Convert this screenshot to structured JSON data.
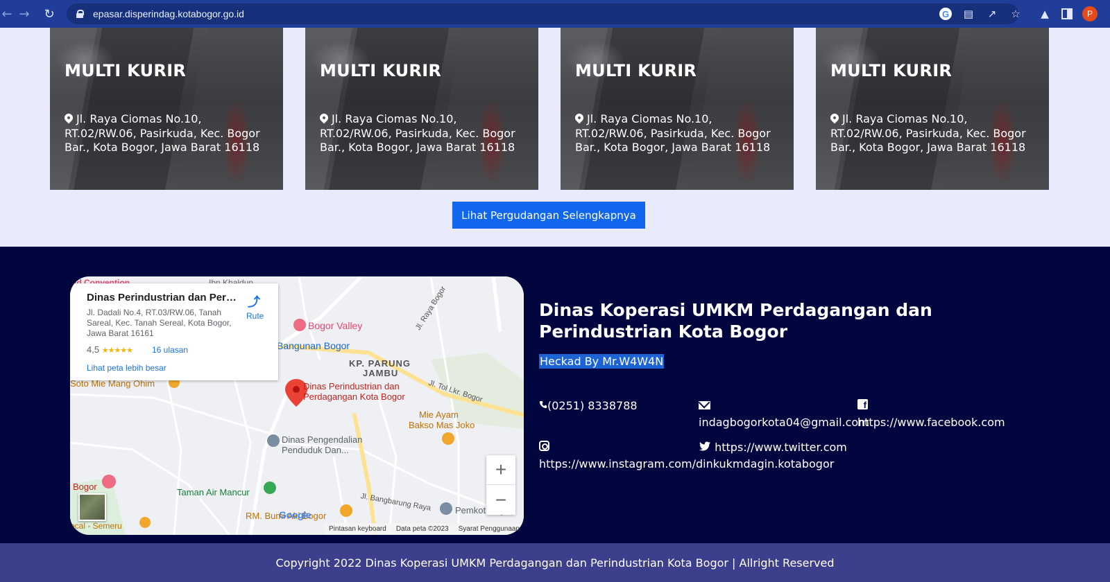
{
  "browser": {
    "url": "epasar.disperindag.kotabogor.go.id",
    "profile_initial": "P",
    "icons": [
      "back-icon",
      "forward-icon",
      "reload-icon",
      "lock-icon",
      "google-icon",
      "translate-icon",
      "share-icon",
      "star-icon",
      "extensions-icon",
      "sidebar-icon",
      "profile-avatar"
    ]
  },
  "warehouses": [
    {
      "name": "MULTI KURIR",
      "address": "Jl. Raya Ciomas No.10, RT.02/RW.06, Pasirkuda, Kec. Bogor Bar., Kota Bogor, Jawa Barat 16118"
    },
    {
      "name": "MULTI KURIR",
      "address": "Jl. Raya Ciomas No.10, RT.02/RW.06, Pasirkuda, Kec. Bogor Bar., Kota Bogor, Jawa Barat 16118"
    },
    {
      "name": "MULTI KURIR",
      "address": "Jl. Raya Ciomas No.10, RT.02/RW.06, Pasirkuda, Kec. Bogor Bar., Kota Bogor, Jawa Barat 16118"
    },
    {
      "name": "MULTI KURIR",
      "address": "Jl. Raya Ciomas No.10, RT.02/RW.06, Pasirkuda, Kec. Bogor Bar., Kota Bogor, Jawa Barat 16118"
    }
  ],
  "more_button": "Lihat Pergudangan Selengkapnya",
  "map": {
    "place_title": "Dinas Perindustrian dan Perda...",
    "place_address": "Jl. Dadali No.4, RT.03/RW.06, Tanah Sareal, Kec. Tanah Sereal, Kota Bogor, Jawa Barat 16161",
    "rating": "4,5",
    "stars": "★★★★★",
    "reviews": "16 ulasan",
    "larger_map": "Lihat peta lebih besar",
    "route": "Rute",
    "zoom_in": "+",
    "zoom_out": "−",
    "google": "Google",
    "attribution": [
      "Pintasan keyboard",
      "Data peta ©2023",
      "Syarat Penggunaan"
    ],
    "labels": {
      "convention": "nd Convention",
      "khaldun": "Ibn Khaldun",
      "bogor_valley": "Bogor Valley",
      "bangunan_bogor": "Bangunan Bogor",
      "kp_parung_1": "KP. PARUNG",
      "kp_parung_2": "JAMBU",
      "soto": "Soto Mie Mang Ohim",
      "pin_1": "Dinas Perindustrian dan",
      "pin_2": "Perdagangan Kota Bogor",
      "tol": "Jl. Tol Lkr. Bogor",
      "mie_1": "Mie Ayam",
      "mie_2": "Bakso Mas Joko",
      "pengendalian_1": "Dinas Pengendalian",
      "pengendalian_2": "Penduduk Dan...",
      "raya_bogor": "Jl. Raya Bogor",
      "bogor": "Bogor",
      "taman": "Taman Air Mancur",
      "bumi": "RM. Bumi Aki Bogor",
      "bangbarung": "Jl. Bangbarung Raya",
      "pemkot": "Pemkot Bog",
      "semeru": "ocal - Semeru"
    }
  },
  "info": {
    "title": "Dinas Koperasi UMKM Perdagangan dan Perindustrian Kota Bogor",
    "hacked_text": "Heckad By Mr.W4W4N",
    "phone": "(0251) 8338788",
    "email": "indagbogorkota04@gmail.com",
    "facebook": "https://www.facebook.com",
    "instagram": "https://www.instagram.com/dinkukmdagin.kotabogor",
    "twitter": "https://www.twitter.com"
  },
  "copyright": "Copyright 2022 Dinas Koperasi UMKM Perdagangan dan Perindustrian Kota Bogor | Allright Reserved"
}
